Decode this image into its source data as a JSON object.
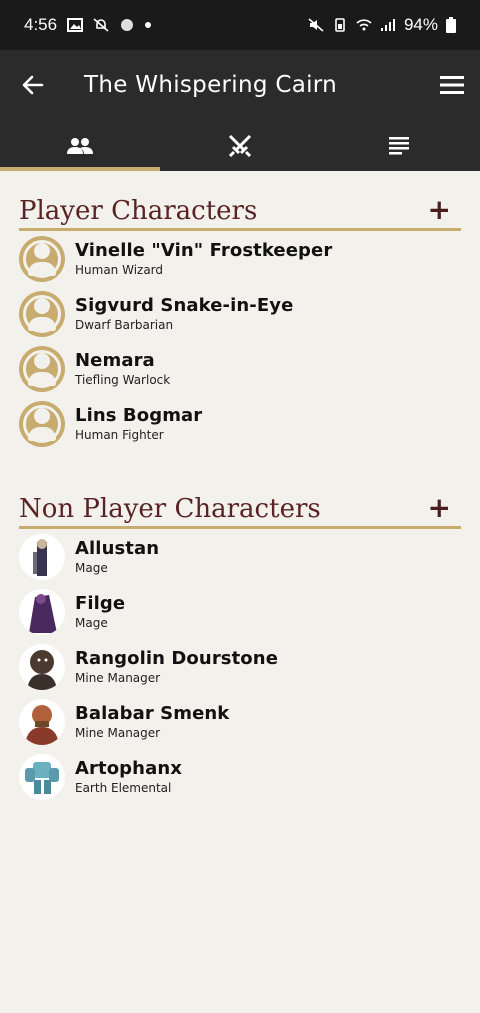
{
  "status_bar": {
    "time": "4:56",
    "battery": "94%"
  },
  "app_bar": {
    "title": "The Whispering Cairn",
    "back_icon": "arrow-left-icon",
    "menu_icon": "hamburger-menu-icon"
  },
  "tabs": [
    {
      "icon": "people-icon",
      "active": true
    },
    {
      "icon": "crossed-swords-icon",
      "active": false
    },
    {
      "icon": "notes-icon",
      "active": false
    }
  ],
  "colors": {
    "accent": "#c8ab6e",
    "section_title": "#5a2323",
    "app_bar": "#2b2b2b",
    "background": "#f3f1ec"
  },
  "player_characters": {
    "title": "Player Characters",
    "add_label": "+",
    "items": [
      {
        "name": "Vinelle \"Vin\" Frostkeeper",
        "subtitle": "Human Wizard"
      },
      {
        "name": "Sigvurd Snake-in-Eye",
        "subtitle": "Dwarf Barbarian"
      },
      {
        "name": "Nemara",
        "subtitle": "Tiefling Warlock"
      },
      {
        "name": "Lins Bogmar",
        "subtitle": "Human Fighter"
      }
    ]
  },
  "non_player_characters": {
    "title": "Non Player Characters",
    "add_label": "+",
    "items": [
      {
        "name": "Allustan",
        "subtitle": "Mage"
      },
      {
        "name": "Filge",
        "subtitle": "Mage"
      },
      {
        "name": "Rangolin Dourstone",
        "subtitle": "Mine Manager"
      },
      {
        "name": "Balabar Smenk",
        "subtitle": "Mine Manager"
      },
      {
        "name": "Artophanx",
        "subtitle": "Earth Elemental"
      }
    ]
  }
}
